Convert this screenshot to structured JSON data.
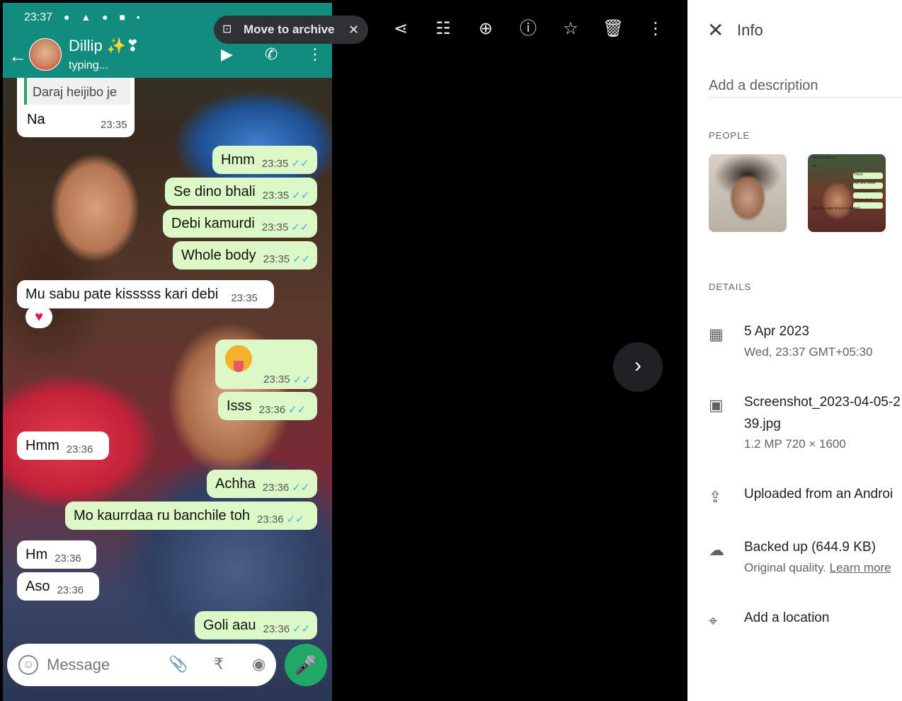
{
  "phone": {
    "status_time": "23:37",
    "status_icons": "● ▲ ● ■ •",
    "contact_name": "Dillip ✨❣",
    "contact_status": "typing...",
    "back_glyph": "←",
    "video_glyph": "▶",
    "call_glyph": "✆",
    "more_glyph": "⋮",
    "quote_text": "Daraj heijibo je",
    "quote_reply": "Na",
    "quote_time": "23:35",
    "messages": [
      {
        "text": "Hmm",
        "time": "23:35",
        "dir": "out"
      },
      {
        "text": "Se dino bhali",
        "time": "23:35",
        "dir": "out"
      },
      {
        "text": "Debi kamurdi",
        "time": "23:35",
        "dir": "out"
      },
      {
        "text": "Whole body",
        "time": "23:35",
        "dir": "out"
      },
      {
        "text": "Mu sabu pate kisssss kari debi",
        "time": "23:35",
        "dir": "in"
      },
      {
        "text": "Isss",
        "time": "23:36",
        "dir": "out"
      },
      {
        "text": "Hmm",
        "time": "23:36",
        "dir": "in"
      },
      {
        "text": "Achha",
        "time": "23:36",
        "dir": "out"
      },
      {
        "text": "Mo kaurrdaa ru banchile toh",
        "time": "23:36",
        "dir": "out"
      },
      {
        "text": "Hm",
        "time": "23:36",
        "dir": "in"
      },
      {
        "text": "Aso",
        "time": "23:36",
        "dir": "in"
      },
      {
        "text": "Goli aau",
        "time": "23:36",
        "dir": "out"
      }
    ],
    "emoji_time": "23:35",
    "tick": "✓✓",
    "reaction": "♥",
    "input_placeholder": "Message",
    "input_emoji": "☺",
    "attach_glyph": "📎",
    "rupee_glyph": "₹",
    "camera_glyph": "◉",
    "mic_glyph": "🎤"
  },
  "toolbar": {
    "archive_label": "Move to archive",
    "archive_icon": "⊡",
    "archive_close": "✕",
    "share": "⋖",
    "edit": "☷",
    "zoom": "⊕",
    "info": "ⓘ",
    "star": "☆",
    "delete": "🗑",
    "more": "⋮",
    "next": "›"
  },
  "info": {
    "close_glyph": "✕",
    "title": "Info",
    "description_placeholder": "Add a description",
    "people_header": "PEOPLE",
    "details_header": "DETAILS",
    "date": "5 Apr 2023",
    "date_detail": "Wed, 23:37   GMT+05:30",
    "file_name_1": "Screenshot_2023-04-05-2",
    "file_name_2": "39.jpg",
    "file_meta": "1.2 MP   720 × 1600",
    "uploaded": "Uploaded from an Androi",
    "backed_up": "Backed up (644.9 KB)",
    "quality_prefix": "Original quality.",
    "learn_more": "Learn more",
    "location": "Add a location",
    "icons": {
      "calendar": "▦",
      "image": "▣",
      "upload": "⇪",
      "cloud": "☁",
      "pin": "⌖"
    }
  },
  "thumb2_lines": [
    "Daraj heijibo je",
    "Na",
    "Hmm",
    "Se dino bhali",
    "Debi kamurdi",
    "Whole body",
    "Mu sabu pate kisssss kari debi"
  ]
}
